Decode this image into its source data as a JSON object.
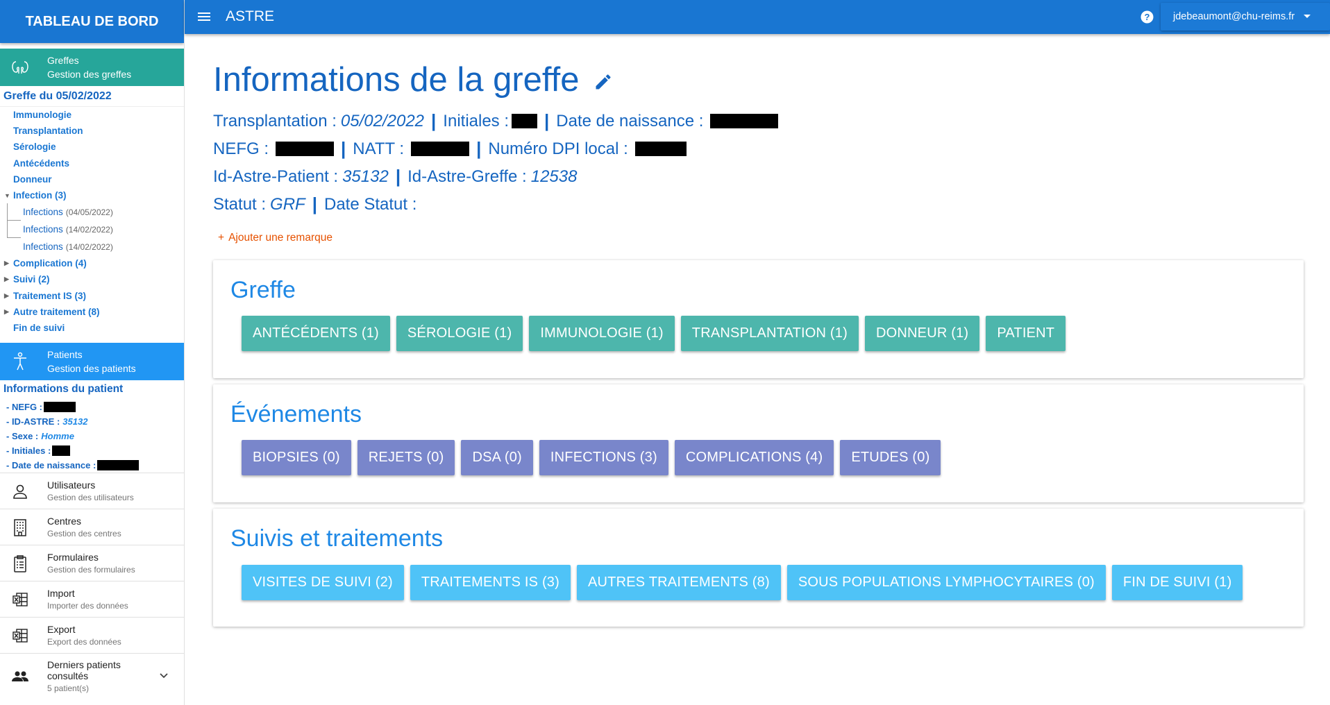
{
  "sidebar": {
    "title": "TABLEAU DE BORD",
    "greffes": {
      "label": "Greffes",
      "sub": "Gestion des greffes"
    },
    "greffe_title": "Greffe du 05/02/2022",
    "tree": [
      {
        "label": "Immunologie"
      },
      {
        "label": "Transplantation"
      },
      {
        "label": "Sérologie"
      },
      {
        "label": "Antécédents"
      },
      {
        "label": "Donneur"
      },
      {
        "label": "Infection (3)",
        "expanded": true
      },
      {
        "label": "Complication (4)"
      },
      {
        "label": "Suivi (2)"
      },
      {
        "label": "Traitement IS (3)"
      },
      {
        "label": "Autre traitement (8)"
      },
      {
        "label": "Fin de suivi"
      }
    ],
    "infections": [
      {
        "label": "Infections",
        "date": "(04/05/2022)"
      },
      {
        "label": "Infections",
        "date": "(14/02/2022)"
      },
      {
        "label": "Infections",
        "date": "(14/02/2022)"
      }
    ],
    "patients": {
      "label": "Patients",
      "sub": "Gestion des patients"
    },
    "patient_info": {
      "title": "Informations du patient",
      "nefg_label": "- NEFG :",
      "idastre_label": "- ID-ASTRE :",
      "idastre_value": "35132",
      "sexe_label": "- Sexe :",
      "sexe_value": "Homme",
      "initiales_label": "- Initiales :",
      "naissance_label": "- Date de naissance :"
    },
    "menu": [
      {
        "label": "Utilisateurs",
        "sub": "Gestion des utilisateurs"
      },
      {
        "label": "Centres",
        "sub": "Gestion des centres"
      },
      {
        "label": "Formulaires",
        "sub": "Gestion des formulaires"
      },
      {
        "label": "Import",
        "sub": "Importer des données"
      },
      {
        "label": "Export",
        "sub": "Export des données"
      },
      {
        "label": "Derniers patients consultés",
        "sub": "5 patient(s)"
      }
    ]
  },
  "topbar": {
    "app_title": "ASTRE",
    "user": "jdebeaumont@chu-reims.fr"
  },
  "main": {
    "title": "Informations de la greffe",
    "line1": {
      "transplantation_label": "Transplantation :",
      "transplantation_value": "05/02/2022",
      "initiales_label": "Initiales :",
      "naissance_label": "Date de naissance :"
    },
    "line2": {
      "nefg_label": "NEFG :",
      "natt_label": "NATT :",
      "dpi_label": "Numéro DPI local :"
    },
    "line3": {
      "patient_label": "Id-Astre-Patient :",
      "patient_value": "35132",
      "greffe_label": "Id-Astre-Greffe :",
      "greffe_value": "12538"
    },
    "line4": {
      "statut_label": "Statut :",
      "statut_value": "GRF",
      "date_statut_label": "Date Statut :"
    },
    "add_remark": "Ajouter une remarque",
    "sections": [
      {
        "title": "Greffe",
        "buttons": [
          "ANTÉCÉDENTS (1)",
          "SÉROLOGIE (1)",
          "IMMUNOLOGIE (1)",
          "TRANSPLANTATION (1)",
          "DONNEUR (1)",
          "PATIENT"
        ]
      },
      {
        "title": "Événements",
        "buttons": [
          "BIOPSIES (0)",
          "REJETS (0)",
          "DSA (0)",
          "INFECTIONS (3)",
          "COMPLICATIONS (4)",
          "ETUDES (0)"
        ]
      },
      {
        "title": "Suivis et traitements",
        "buttons": [
          "VISITES DE SUIVI (2)",
          "TRAITEMENTS IS (3)",
          "AUTRES TRAITEMENTS (8)",
          "SOUS POPULATIONS LYMPHOCYTAIRES (0)",
          "FIN DE SUIVI (1)"
        ]
      }
    ]
  },
  "colors": {
    "primary": "#1976d2",
    "teal": "#4db6ac",
    "indigo": "#7986cb",
    "light_blue": "#4fc3f7",
    "accent_orange": "#e65100"
  }
}
